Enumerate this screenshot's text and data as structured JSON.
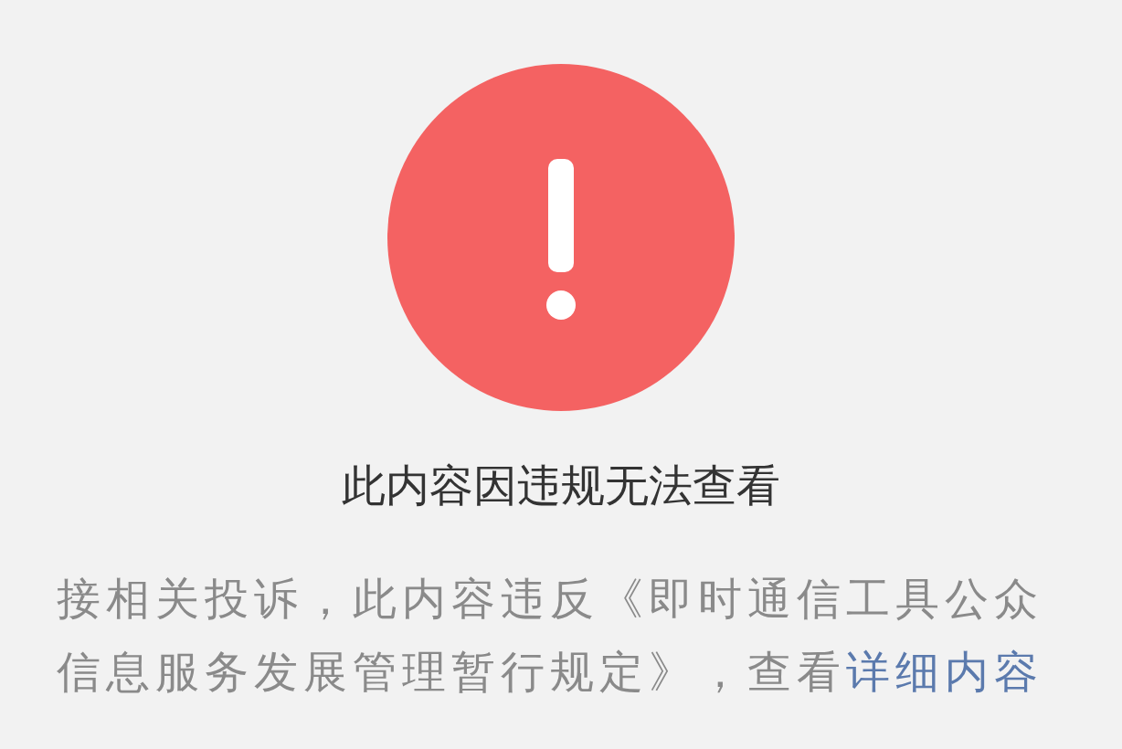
{
  "title": "此内容因违规无法查看",
  "message": {
    "text": "接相关投诉，此内容违反《即时通信工具公众信息服务发展管理暂行规定》，查看",
    "link": "详细内容"
  }
}
